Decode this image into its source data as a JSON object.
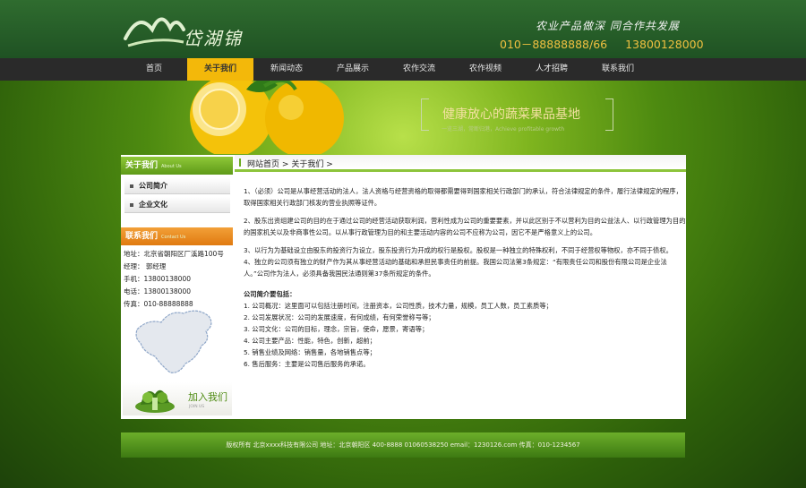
{
  "header": {
    "logo_text": "岱湖锦",
    "slogan": "农业产品做深  同合作共发展",
    "phone1": "010－88888888/66",
    "phone2": "13800128000"
  },
  "nav": {
    "items": [
      "首页",
      "关于我们",
      "新闻动态",
      "产品展示",
      "农作交流",
      "农作视频",
      "人才招聘",
      "联系我们"
    ],
    "active": "关于我们"
  },
  "banner": {
    "title": "健康放心的蔬菜果品基地",
    "subtitle": "一览三湖，常断归港，Achieve profitable growth"
  },
  "sidebar": {
    "about_title": "关于我们",
    "about_en": "About Us",
    "links": [
      "公司简介",
      "企业文化"
    ],
    "contact_title": "联系我们",
    "contact_en": "Contact Us",
    "contact": {
      "address": "地址：北京省朝阳区厂溪路100号",
      "manager": "经理： 郭经理",
      "mobile": "手机：13800138000",
      "tel": "电话：13800138000",
      "fax": "传真：010-88888888"
    },
    "join_text": "加入我们",
    "join_en": "JOIN US"
  },
  "breadcrumb": {
    "home": "网站首页",
    "sep": ">",
    "current": "关于我们"
  },
  "content": {
    "paragraphs": [
      "1、（必须）公司是从事经营活动的法人，法人资格与经营资格的取得都需要得到国家相关行政部门的承认，符合法律规定的条件，履行法律规定的程序，取得国家相关行政部门核发的营业执照等证件。",
      "2、股东出资组建公司的目的在于通过公司的经营活动获取利润，营利性成为公司的重要要素，并以此区别于不以营利为目的公益法人、以行政管理为目的的国家机关以及非商事性公司。以从事行政管理为目的和主要活动内容的公司不应称为公司，因它不是严格意义上的公司。",
      "3、以行为为基础设立由股东的投资行为设立，股东投资行为开成的权行是股权。股权是一种独立的特殊权利，不同于经营权等物权，亦不同于债权。",
      "4、独立的公司须有独立的财产作为其从事经营活动的基础和承担民事责任的前提。我国公司法第3条规定：“有限责任公司和股份有限公司是企业法人。”公司作为法人，必须具备我国民法通则第37条所规定的条件。"
    ],
    "intro_title": "公司简介要包括：",
    "intro_items": [
      "1. 公司概况：这里面可以包括注册时间，注册资本，公司性质，技术力量，规模，员工人数，员工素质等；",
      "2. 公司发展状况：公司的发展速度，有何成绩，有何荣誉称号等；",
      "3. 公司文化：公司的目标，理念，宗旨，使命，愿景，寄语等；",
      "4. 公司主要产品：性能，特色，创新，超前；",
      "5. 销售业绩及网络：销售量，各地销售点等；",
      "6. 售后服务：主要是公司售后服务的承诺。"
    ]
  },
  "footer": {
    "text": "版权所有 北京xxxx科技有限公司 地址：北京朝阳区 400-8888 01060538250 email：1230126.com 传真：010-1234567"
  },
  "colors": {
    "accent": "#f3b80a",
    "green": "#8cc43a",
    "orange": "#e07a10"
  }
}
